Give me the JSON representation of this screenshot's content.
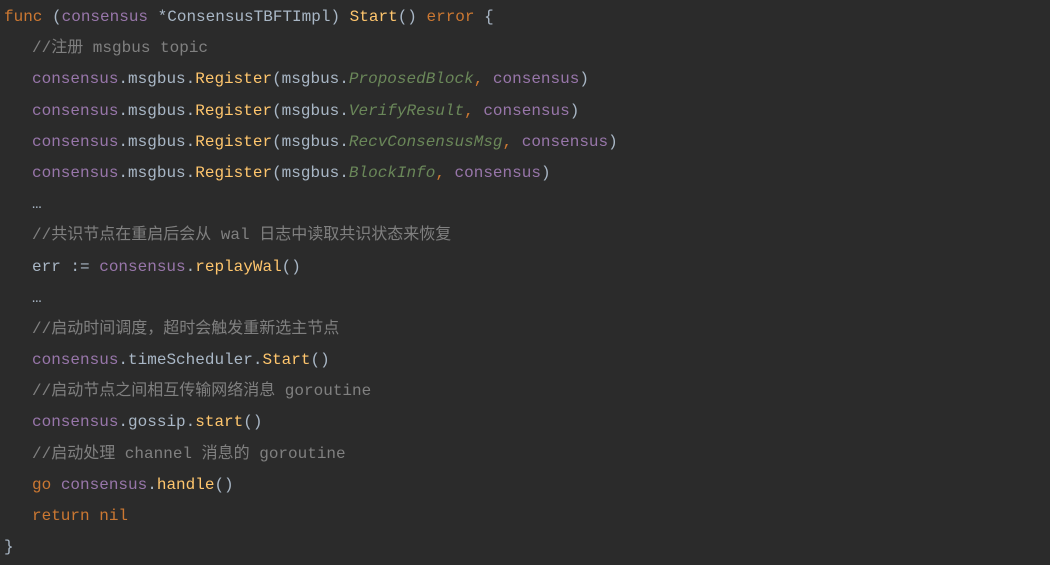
{
  "lines": {
    "func_kw": "func",
    "consensus_param": "consensus",
    "star": " *",
    "type_name": "ConsensusTBFTImpl",
    "start_method": "Start",
    "error_type": "error",
    "open_brace": " {",
    "comment1": "//注册 msgbus topic",
    "consensus_ref": "consensus",
    "dot": ".",
    "msgbus": "msgbus",
    "register": "Register",
    "proposed_block": "ProposedBlock",
    "verify_result": "VerifyResult",
    "recv_consensus_msg": "RecvConsensusMsg",
    "block_info": "BlockInfo",
    "ellipsis": "…",
    "comment2": "//共识节点在重启后会从 wal 日志中读取共识状态来恢复",
    "err_var": "err ",
    "assign": ":=",
    "replay_wal": "replayWal",
    "comment3": "//启动时间调度，超时会触发重新选主节点",
    "time_scheduler": "timeScheduler",
    "start": "Start",
    "start_lower": "start",
    "comment4": "//启动节点之间相互传输网络消息 goroutine",
    "gossip": "gossip",
    "comment5": "//启动处理 channel 消息的 goroutine",
    "go_kw": "go",
    "handle": "handle",
    "return_kw": "return",
    "nil_kw": " nil",
    "close_brace": "}",
    "open_paren": "(",
    "close_paren": ")",
    "open_paren_space": " (",
    "close_paren_space": ") ",
    "empty_parens": "()",
    "comma": ", ",
    "space": " "
  }
}
